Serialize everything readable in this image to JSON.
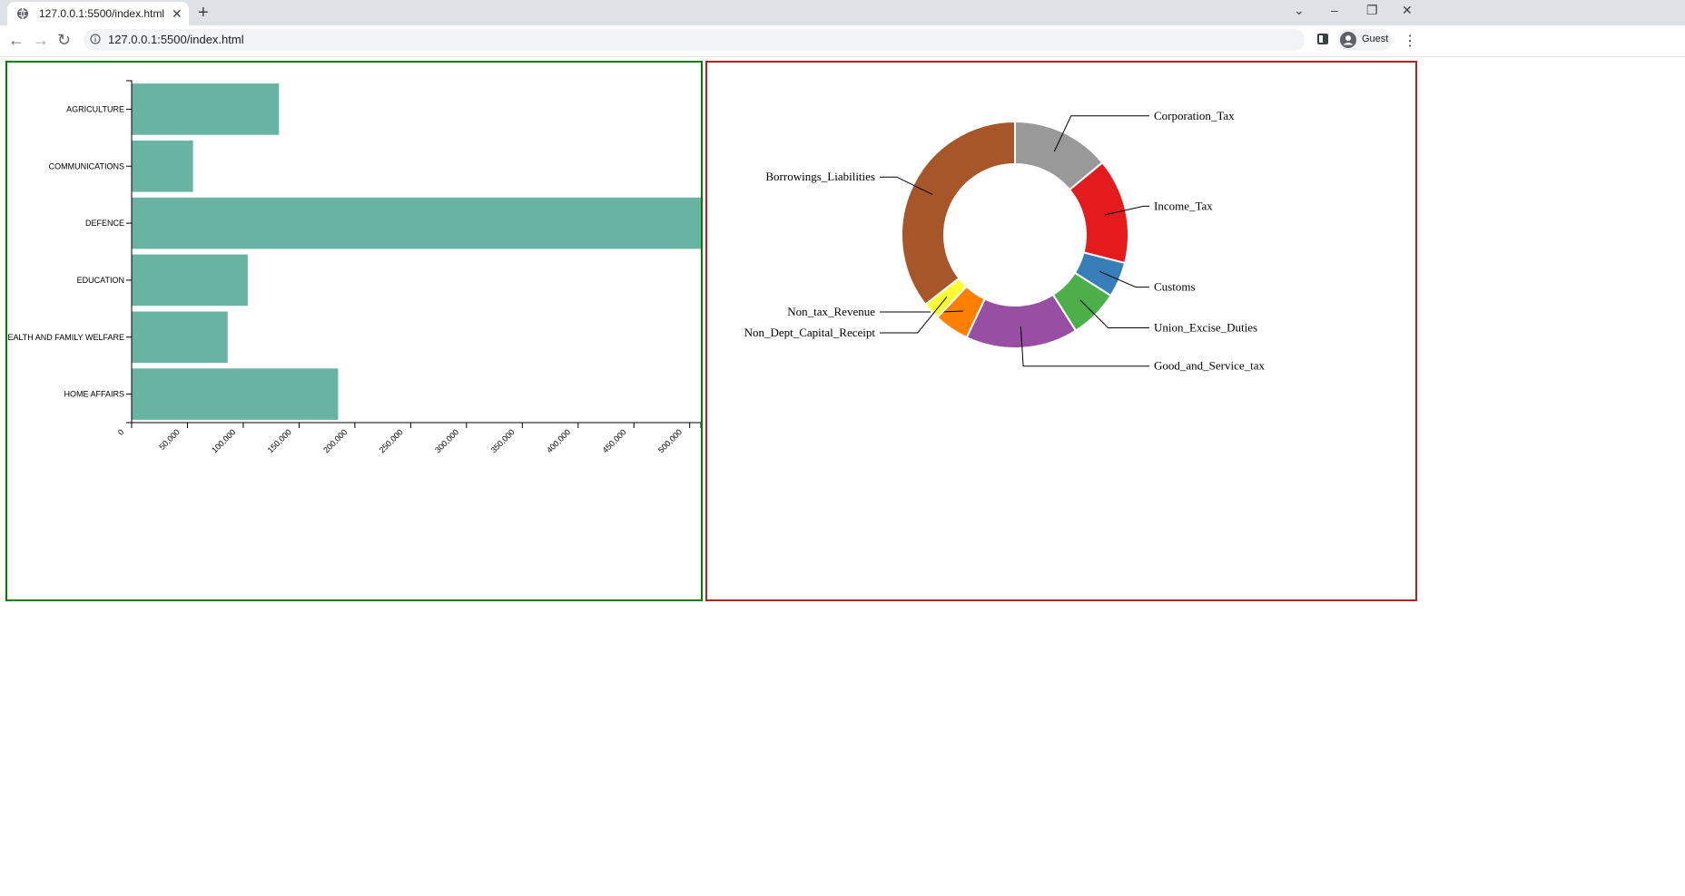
{
  "browser": {
    "tab_title": "127.0.0.1:5500/index.html",
    "url": "127.0.0.1:5500/index.html",
    "profile_label": "Guest",
    "icons": [
      "globe-icon",
      "close-icon",
      "plus-icon",
      "chevron-down-icon",
      "minimize-icon",
      "restore-icon",
      "close-window-icon",
      "back-arrow-icon",
      "forward-arrow-icon",
      "reload-icon",
      "info-icon",
      "side-panel-icon",
      "avatar-icon",
      "menu-dots-icon"
    ]
  },
  "colors": {
    "bar_fill": "#69b3a2",
    "bar_panel_border": "#008000",
    "pie_panel_border": "#b22222"
  },
  "chart_data": [
    {
      "type": "bar",
      "orientation": "horizontal",
      "categories": [
        "AGRICULTURE",
        "COMMUNICATIONS",
        "DEFENCE",
        "EDUCATION",
        "HEALTH AND FAMILY WELFARE",
        "HOME AFFAIRS"
      ],
      "values": [
        132000,
        55000,
        525000,
        104000,
        86000,
        185000
      ],
      "xlim": [
        0,
        510000
      ],
      "x_ticks": [
        0,
        50000,
        100000,
        150000,
        200000,
        250000,
        300000,
        350000,
        400000,
        450000,
        500000
      ],
      "x_tick_labels": [
        "0",
        "50,000",
        "100,000",
        "150,000",
        "200,000",
        "250,000",
        "300,000",
        "350,000",
        "400,000",
        "450,000",
        "500,000"
      ],
      "title": "",
      "xlabel": "",
      "ylabel": "",
      "grid": false
    },
    {
      "type": "pie",
      "donut": true,
      "labels": [
        "Corporation_Tax",
        "Income_Tax",
        "Customs",
        "Union_Excise_Duties",
        "Good_and_Service_tax",
        "Non_tax_Revenue",
        "Non_Dept_Capital_Receipt",
        "Borrowings_Liabilities"
      ],
      "values": [
        14,
        15,
        5,
        7,
        16,
        5,
        2.5,
        35.5
      ],
      "colors": [
        "#999999",
        "#e41a1c",
        "#377eb8",
        "#4daf4a",
        "#984ea3",
        "#ff7f00",
        "#ffff33",
        "#a65628"
      ],
      "title": ""
    }
  ]
}
